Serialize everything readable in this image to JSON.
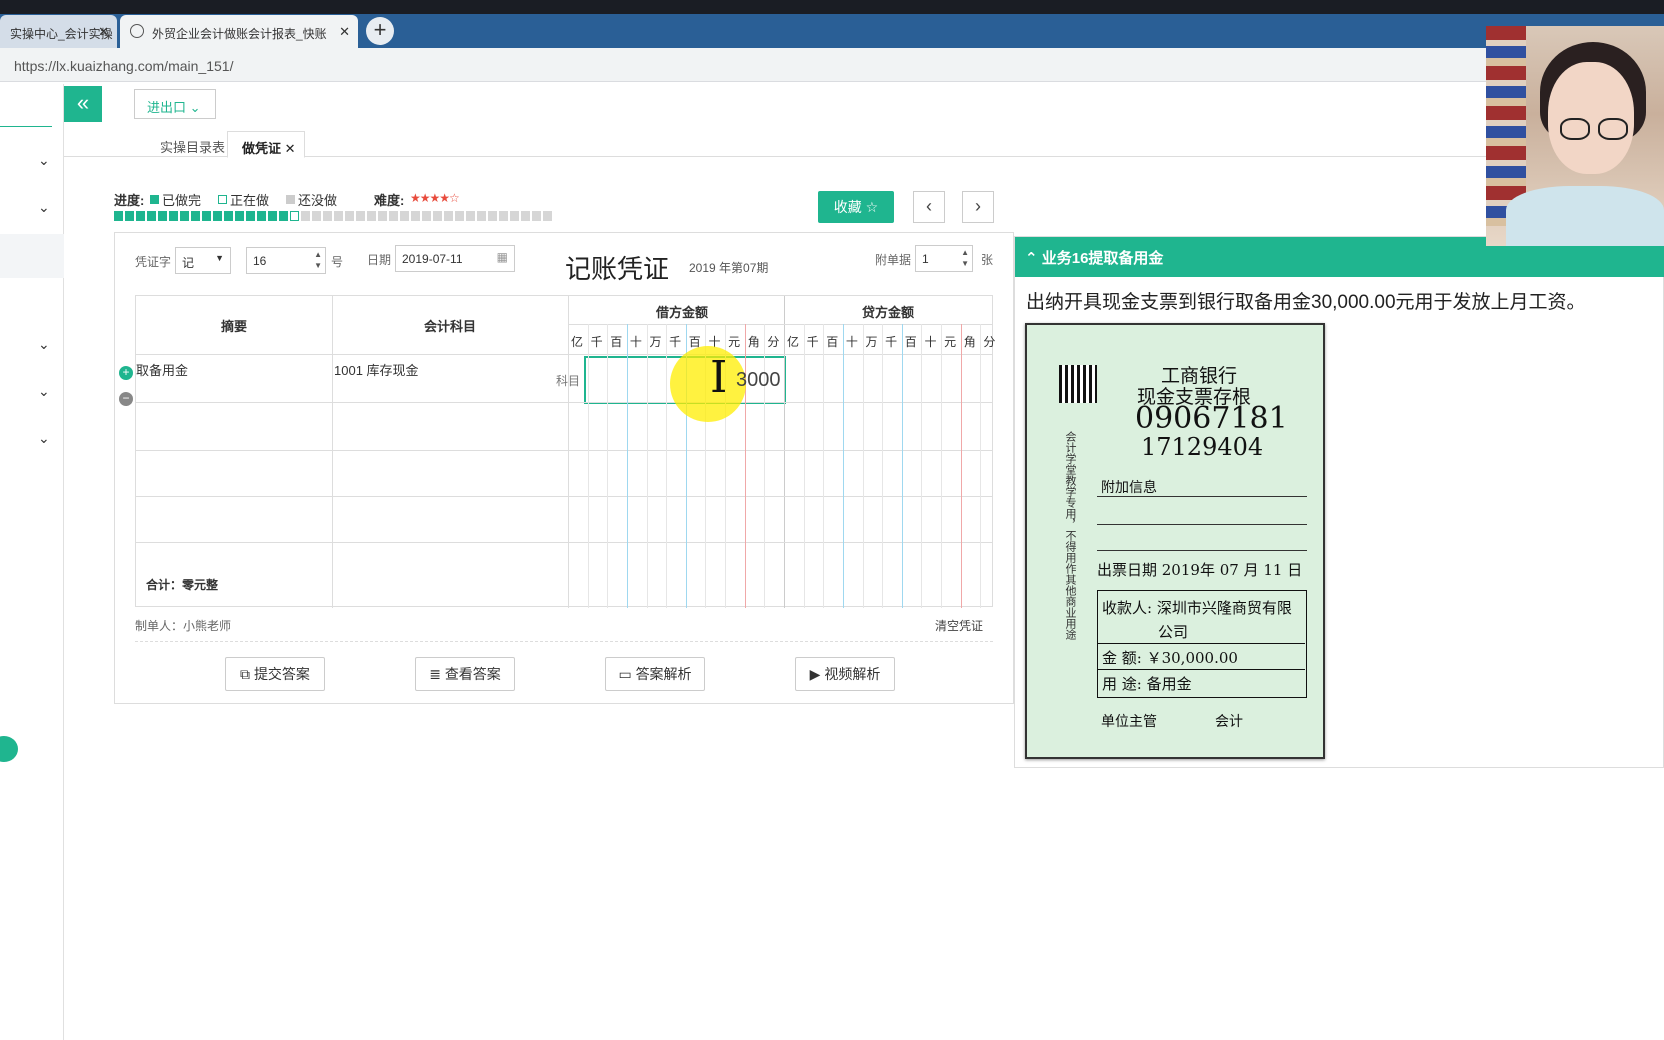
{
  "browser": {
    "tab_inactive": "实操中心_会计实操",
    "tab_active": "外贸企业会计做账会计报表_快账",
    "url": "https://lx.kuaizhang.com/main_151/"
  },
  "toolbar": {
    "dropdown": "进出口 ⌄"
  },
  "page_tabs": [
    "实操目录表",
    "做凭证"
  ],
  "progress": {
    "label": "进度:",
    "done": "已做完",
    "doing": "正在做",
    "todo": "还没做",
    "difficulty_label": "难度:",
    "difficulty_stars": "★★★★☆",
    "done_count": 16,
    "current_index": 17,
    "total": 40
  },
  "buttons": {
    "favorite": "收藏 ☆",
    "prev": "‹",
    "next": "›",
    "submit": "提交答案",
    "view_answer": "查看答案",
    "answer_analysis": "答案解析",
    "video_analysis": "视频解析"
  },
  "voucher": {
    "word_label": "凭证字",
    "word_value": "记",
    "number_value": "16",
    "number_suffix": "号",
    "date_label": "日期",
    "date_value": "2019-07-11",
    "title": "记账凭证",
    "period": "2019 年第07期",
    "attach_label": "附单据",
    "attach_value": "1",
    "attach_suffix": "张",
    "col_summary": "摘要",
    "col_account": "会计科目",
    "col_debit": "借方金额",
    "col_credit": "贷方金额",
    "digits": [
      "亿",
      "千",
      "百",
      "十",
      "万",
      "千",
      "百",
      "十",
      "元",
      "角",
      "分"
    ],
    "row1_summary": "取备用金",
    "row1_account": "1001 库存现金",
    "row1_subject": "科目",
    "row1_amount": "3000",
    "total_label": "合计：零元整",
    "maker": "制单人：小熊老师",
    "clear": "清空凭证"
  },
  "business": {
    "title": "业务16提取备用金",
    "description": "出纳开具现金支票到银行取备用金30,000.00元用于发放上月工资。",
    "cheque": {
      "bank": "工商银行",
      "type": "现金支票存根",
      "code1": "09067181",
      "code2": "17129404",
      "extra_info": "附加信息",
      "issue_date": "出票日期 2019年  07 月  11 日",
      "payee": "收款人: 深圳市兴隆商贸有限",
      "payee2": "公司",
      "amount": "金    额: ￥30,000.00",
      "purpose": "用    途: 备用金",
      "manager": "单位主管",
      "accountant": "会计",
      "side_text": "会计学堂教学专用，不得用作其他商业用途"
    }
  }
}
